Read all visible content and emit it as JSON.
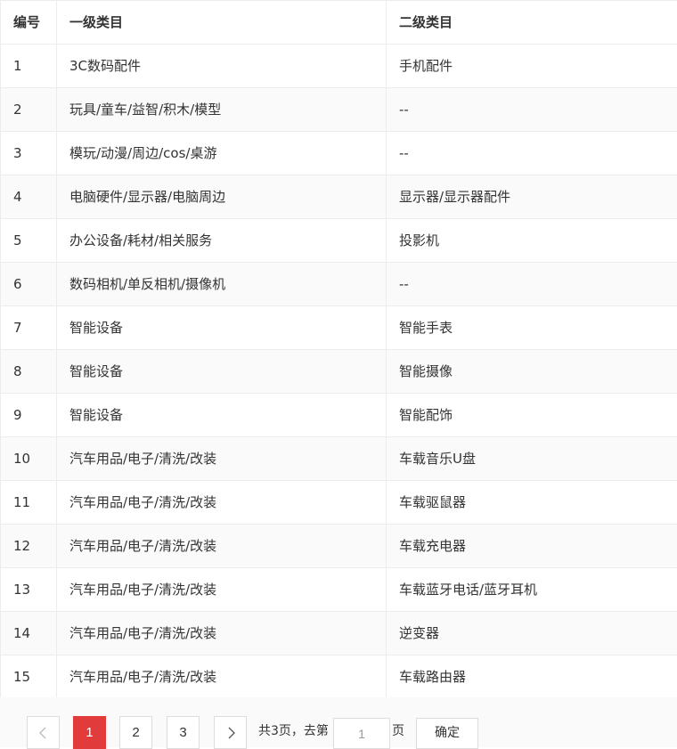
{
  "table": {
    "headers": [
      "编号",
      "一级类目",
      "二级类目"
    ],
    "rows": [
      [
        "1",
        "3C数码配件",
        "手机配件"
      ],
      [
        "2",
        "玩具/童车/益智/积木/模型",
        "--"
      ],
      [
        "3",
        "模玩/动漫/周边/cos/桌游",
        "--"
      ],
      [
        "4",
        "电脑硬件/显示器/电脑周边",
        "显示器/显示器配件"
      ],
      [
        "5",
        "办公设备/耗材/相关服务",
        "投影机"
      ],
      [
        "6",
        "数码相机/单反相机/摄像机",
        "--"
      ],
      [
        "7",
        "智能设备",
        "智能手表"
      ],
      [
        "8",
        "智能设备",
        "智能摄像"
      ],
      [
        "9",
        "智能设备",
        "智能配饰"
      ],
      [
        "10",
        "汽车用品/电子/清洗/改装",
        "车载音乐U盘"
      ],
      [
        "11",
        "汽车用品/电子/清洗/改装",
        "车载驱鼠器"
      ],
      [
        "12",
        "汽车用品/电子/清洗/改装",
        "车载充电器"
      ],
      [
        "13",
        "汽车用品/电子/清洗/改装",
        "车载蓝牙电话/蓝牙耳机"
      ],
      [
        "14",
        "汽车用品/电子/清洗/改装",
        "逆变器"
      ],
      [
        "15",
        "汽车用品/电子/清洗/改装",
        "车载路由器"
      ]
    ]
  },
  "pagination": {
    "prev_icon": "chevron-left-icon",
    "next_icon": "chevron-right-icon",
    "pages": [
      "1",
      "2",
      "3"
    ],
    "current_page": "1",
    "total_text": "共3页，去第",
    "page_input_value": "1",
    "page_suffix": "页",
    "confirm_label": "确定",
    "active_color": "#e23b3b"
  }
}
